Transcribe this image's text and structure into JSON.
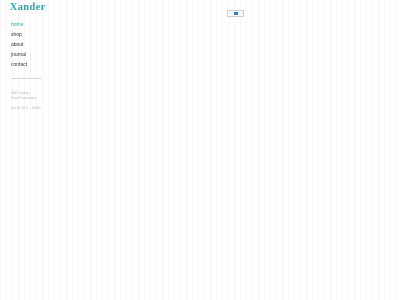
{
  "brand": {
    "logo_text": "Xander",
    "accent_color": "#2aa3a8"
  },
  "nav": {
    "items": [
      {
        "label": "home",
        "active": true
      },
      {
        "label": "shop",
        "active": false
      },
      {
        "label": "about",
        "active": false
      },
      {
        "label": "journal",
        "active": false
      },
      {
        "label": "contact",
        "active": false
      }
    ]
  },
  "contact": {
    "address_line_1": "360 Ostrip",
    "address_line_2": "San Francisco",
    "phone": "(415) 872 - 9085"
  },
  "header": {
    "cart_icon": "cart-icon"
  }
}
